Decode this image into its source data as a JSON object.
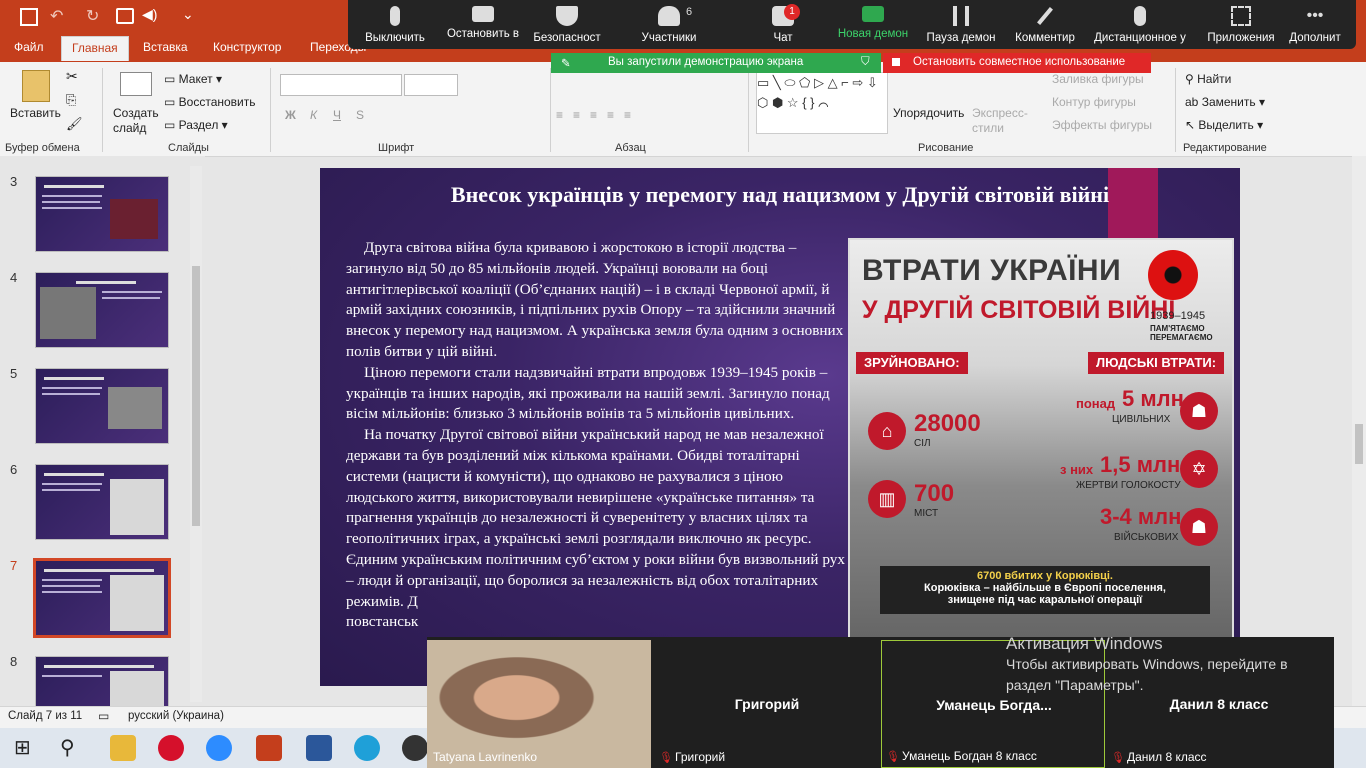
{
  "ribbon": {
    "tabs": [
      "Файл",
      "Главная",
      "Вставка",
      "Конструктор",
      "Переходы"
    ],
    "active_tab": "Главная",
    "clipboard": {
      "paste": "Вставить",
      "group": "Буфер обмена"
    },
    "slides": {
      "new_slide": "Создать слайд",
      "layout": "Макет",
      "reset": "Восстановить",
      "section": "Раздел",
      "group": "Слайды"
    },
    "font": {
      "group": "Шрифт",
      "bold": "Ж",
      "italic": "К",
      "underline": "Ч",
      "strike": "S"
    },
    "paragraph": {
      "group": "Абзац"
    },
    "drawing": {
      "group": "Рисование",
      "arrange": "Упорядочить",
      "quick_styles": "Экспресс-стили",
      "fill": "Заливка фигуры",
      "outline": "Контур фигуры",
      "effects": "Эффекты фигуры"
    },
    "editing": {
      "group": "Редактирование",
      "find": "Найти",
      "replace": "Заменить",
      "select": "Выделить"
    }
  },
  "zoom": {
    "buttons": [
      {
        "label": "Выключить",
        "icon": "microphone-icon"
      },
      {
        "label": "Остановить в",
        "icon": "video-camera-icon"
      },
      {
        "label": "Безопасност",
        "icon": "shield-icon"
      },
      {
        "label": "Участники",
        "icon": "participants-icon",
        "badge": "6"
      },
      {
        "label": "Чат",
        "icon": "chat-icon",
        "badge": "1"
      },
      {
        "label": "Новая демон",
        "icon": "share-screen-icon"
      },
      {
        "label": "Пауза демон",
        "icon": "pause-icon"
      },
      {
        "label": "Комментир",
        "icon": "pen-icon"
      },
      {
        "label": "Дистанционное у",
        "icon": "mouse-icon"
      },
      {
        "label": "Приложения",
        "icon": "apps-icon"
      },
      {
        "label": "Дополнит",
        "icon": "more-icon"
      }
    ],
    "share_notice": "Вы запустили демонстрацию экрана",
    "stop_share": "Остановить совместное использование",
    "accent": "#2fa84f",
    "stop_color": "#e02828"
  },
  "thumbnails": [
    {
      "num": "3",
      "selected": false
    },
    {
      "num": "4",
      "selected": false
    },
    {
      "num": "5",
      "selected": false
    },
    {
      "num": "6",
      "selected": false
    },
    {
      "num": "7",
      "selected": true
    },
    {
      "num": "8",
      "selected": false
    }
  ],
  "slide": {
    "title": "Внесок українців у перемогу над нацизмом у Другій світовій війні",
    "paragraphs": [
      "Друга світова війна була кривавою і жорстокою в історії людства – загинуло від 50 до 85 мільйонів людей. Українці воювали на боці антигітлерівської коаліції (Об’єднаних націй) – і в складі Червоної армії, й армій західних союзників, і підпільних рухів Опору – та здійснили значний внесок у перемогу над нацизмом. А українська земля була одним з основних полів битви у цій війні.",
      "Ціною перемоги стали надзвичайні втрати впродовж 1939–1945 років – українців та інших народів, які проживали на нашій землі. Загинуло понад вісім мільйонів: близько 3 мільйонів воїнів та 5 мільйонів цивільних.",
      "На початку Другої світової війни український народ не мав незалежної держави та був розділений між кількома країнами. Обидві тоталітарні системи (нацисти й комуністи), що однаково не рахувалися з ціною людського життя, використовували невирішене «українське питання» та прагнення українців до незалежності й суверенітету у власних цілях та геополітичних іграх, а українські землі розглядали виключно як ресурс. Єдиним українським політичним суб’єктом у роки війни був визвольний рух – люди й організації, що боролися за незалежність від обох тоталітарних режимів. Д",
      "повстанськ"
    ],
    "infographic": {
      "title1": "ВТРАТИ УКРАЇНИ",
      "title2": "У ДРУГІЙ СВІТОВІЙ ВІЙНІ",
      "years": "1939–1945",
      "memory": "ПАМ'ЯТАЄМО ПЕРЕМАГАЄМО",
      "destroyed": "ЗРУЙНОВАНО:",
      "human_losses": "ЛЮДСЬКІ ВТРАТИ:",
      "villages_num": "28000",
      "villages_lbl": "СІЛ",
      "towns_num": "700",
      "towns_lbl": "МІСТ",
      "civ_pre": "понад",
      "civ_num": "5 млн",
      "civ_lbl": "ЦИВІЛЬНИХ",
      "holo_pre": "з них",
      "holo_num": "1,5 млн",
      "holo_lbl": "ЖЕРТВИ ГОЛОКОСТУ",
      "mil_num": "3-4 млн",
      "mil_lbl": "ВІЙСЬКОВИХ",
      "foot1": "6700 вбитих у Корюківці.",
      "foot2": "Корюківка – найбільше в Європі поселення,",
      "foot3": "знищене під час каральної операції"
    }
  },
  "status": {
    "slide_info": "Слайд 7 из 11",
    "language": "русский (Украина)"
  },
  "video": [
    {
      "name": "",
      "caption": "Tatyana Lavrinenko",
      "muted": false
    },
    {
      "name": "Григорий",
      "caption": "Григорий",
      "muted": true
    },
    {
      "name": "Уманець  Богда...",
      "caption": "Уманець Богдан 8 класс",
      "muted": true
    },
    {
      "name": "Данил 8 класс",
      "caption": "Данил 8 класс",
      "muted": true
    }
  ],
  "watermark": {
    "line1": "Активация Windows",
    "line2": "Чтобы активировать Windows, перейдите в",
    "line3": "раздел \"Параметры\"."
  }
}
